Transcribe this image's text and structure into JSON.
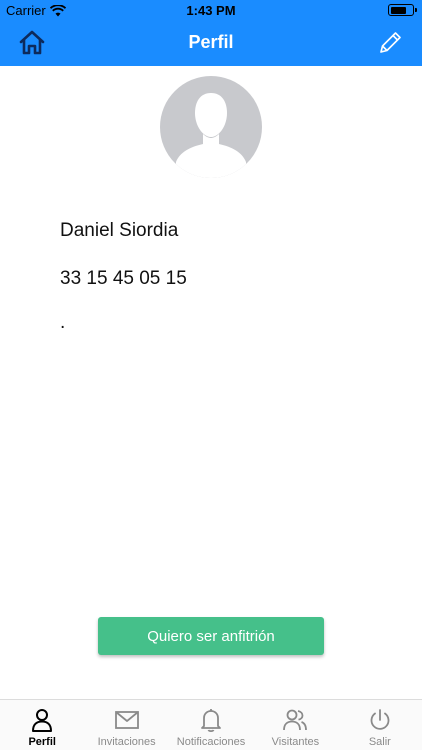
{
  "status_bar": {
    "carrier": "Carrier",
    "time": "1:43 PM",
    "battery_level": 0.75
  },
  "nav": {
    "title": "Perfil",
    "left_icon": "home-icon",
    "right_icon": "edit-icon"
  },
  "profile": {
    "name": "Daniel Siordia",
    "phone": "33 15 45 05 15",
    "extra": "."
  },
  "cta": {
    "label": "Quiero ser anfitrión"
  },
  "tabs": [
    {
      "label": "Perfil",
      "icon": "person-icon",
      "active": true
    },
    {
      "label": "Invitaciones",
      "icon": "mail-icon",
      "active": false
    },
    {
      "label": "Notificaciones",
      "icon": "bell-icon",
      "active": false
    },
    {
      "label": "Visitantes",
      "icon": "users-icon",
      "active": false
    },
    {
      "label": "Salir",
      "icon": "power-icon",
      "active": false
    }
  ],
  "colors": {
    "header": "#1a8cff",
    "cta": "#45c08a",
    "avatar": "#c8c9cd",
    "tab_inactive": "#8a8a8a"
  }
}
